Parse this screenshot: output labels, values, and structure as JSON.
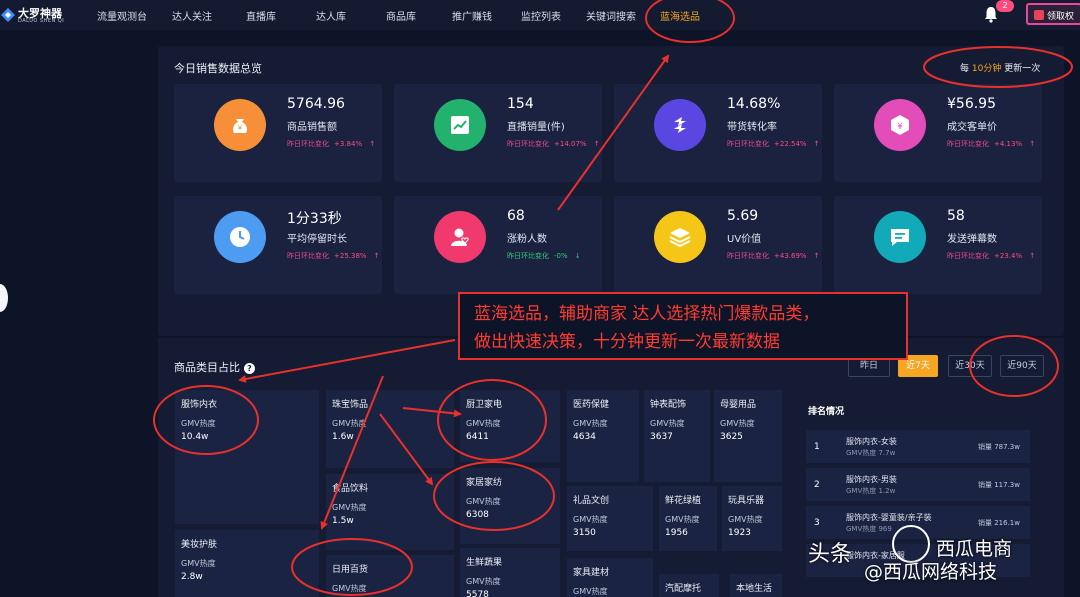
{
  "nav": {
    "logo_cn": "大罗神器",
    "logo_en": "DALUO SHEN QI",
    "items": [
      "流量观测台",
      "达人关注",
      "直播库",
      "达人库",
      "商品库",
      "推广赚钱",
      "监控列表",
      "关键词搜索",
      "蓝海选品"
    ],
    "badge": "2",
    "gift_label": "领取权"
  },
  "overview": {
    "title": "今日销售数据总览",
    "update_prefix": "每 ",
    "update_highlight": "10分钟",
    "update_suffix": " 更新一次",
    "cards": [
      {
        "value": "5764.96",
        "label": "商品销售额",
        "cmp_label": "昨日环比变化",
        "cmp": "+3.84%",
        "dir": "up",
        "icon": "money-bag-icon",
        "color": "#f78f38"
      },
      {
        "value": "154",
        "label": "直播销量(件)",
        "cmp_label": "昨日环比变化",
        "cmp": "+14.07%",
        "dir": "up",
        "icon": "chart-up-icon",
        "color": "#23b26d"
      },
      {
        "value": "14.68%",
        "label": "带货转化率",
        "cmp_label": "昨日环比变化",
        "cmp": "+22.54%",
        "dir": "up",
        "icon": "exchange-icon",
        "color": "#5a46e0"
      },
      {
        "value": "¥56.95",
        "label": "成交客单价",
        "cmp_label": "昨日环比变化",
        "cmp": "+4.13%",
        "dir": "up",
        "icon": "yen-hexagon-icon",
        "color": "#e34db9"
      },
      {
        "value": "1分33秒",
        "label": "平均停留时长",
        "cmp_label": "昨日环比变化",
        "cmp": "+25.38%",
        "dir": "up",
        "icon": "clock-icon",
        "color": "#4e9cf2"
      },
      {
        "value": "68",
        "label": "涨粉人数",
        "cmp_label": "昨日环比变化",
        "cmp": "-0%",
        "dir": "down",
        "icon": "user-heart-icon",
        "color": "#f03a6e"
      },
      {
        "value": "5.69",
        "label": "UV价值",
        "cmp_label": "昨日环比变化",
        "cmp": "+43.69%",
        "dir": "up",
        "icon": "layers-icon",
        "color": "#f5c518"
      },
      {
        "value": "58",
        "label": "发送弹幕数",
        "cmp_label": "昨日环比变化",
        "cmp": "+23.4%",
        "dir": "up",
        "icon": "comment-icon",
        "color": "#12a9b8"
      }
    ]
  },
  "annotation": {
    "line1": "蓝海选品，辅助商家 达人选择热门爆款品类，",
    "line2": "做出快速决策，十分钟更新一次最新数据"
  },
  "category": {
    "title": "商品类目占比",
    "filters": [
      {
        "label": "昨日",
        "active": false
      },
      {
        "label": "近7天",
        "active": true
      },
      {
        "label": "近30天",
        "active": false
      },
      {
        "label": "近90天",
        "active": false
      }
    ],
    "gmv_label": "GMV热度",
    "tiles": [
      {
        "name": "服饰内衣",
        "value": "10.4w"
      },
      {
        "name": "珠宝饰品",
        "value": "1.6w"
      },
      {
        "name": "厨卫家电",
        "value": "6411"
      },
      {
        "name": "医药保健",
        "value": "4634"
      },
      {
        "name": "钟表配饰",
        "value": "3637"
      },
      {
        "name": "母婴用品",
        "value": "3625"
      },
      {
        "name": "食品饮料",
        "value": "1.5w"
      },
      {
        "name": "家居家纺",
        "value": "6308"
      },
      {
        "name": "礼品文创",
        "value": "3150"
      },
      {
        "name": "鲜花绿植",
        "value": "1956"
      },
      {
        "name": "玩具乐器",
        "value": "1923"
      },
      {
        "name": "美妆护肤",
        "value": "2.8w"
      },
      {
        "name": "日用百货",
        "value": ""
      },
      {
        "name": "生鲜蔬果",
        "value": "5578"
      },
      {
        "name": "家具建材",
        "value": ""
      },
      {
        "name": "汽配摩托",
        "value": ""
      },
      {
        "name": "本地生活",
        "value": ""
      }
    ]
  },
  "ranking": {
    "title": "排名情况",
    "rows": [
      {
        "rank": "1",
        "name": "服饰内衣-女装",
        "gmv": "GMV热度 7.7w",
        "sales": "销量 787.3w"
      },
      {
        "rank": "2",
        "name": "服饰内衣-男装",
        "gmv": "GMV热度 1.2w",
        "sales": "销量 117.3w"
      },
      {
        "rank": "3",
        "name": "服饰内衣-婴童装/亲子装",
        "gmv": "GMV热度 969",
        "sales": "销量 216.1w"
      },
      {
        "rank": "",
        "name": "服饰内衣-家居服",
        "gmv": "",
        "sales": ""
      }
    ]
  },
  "watermark": {
    "left": "头条",
    "handle": "@西瓜网络科技",
    "wechat_name": "西瓜电商"
  }
}
